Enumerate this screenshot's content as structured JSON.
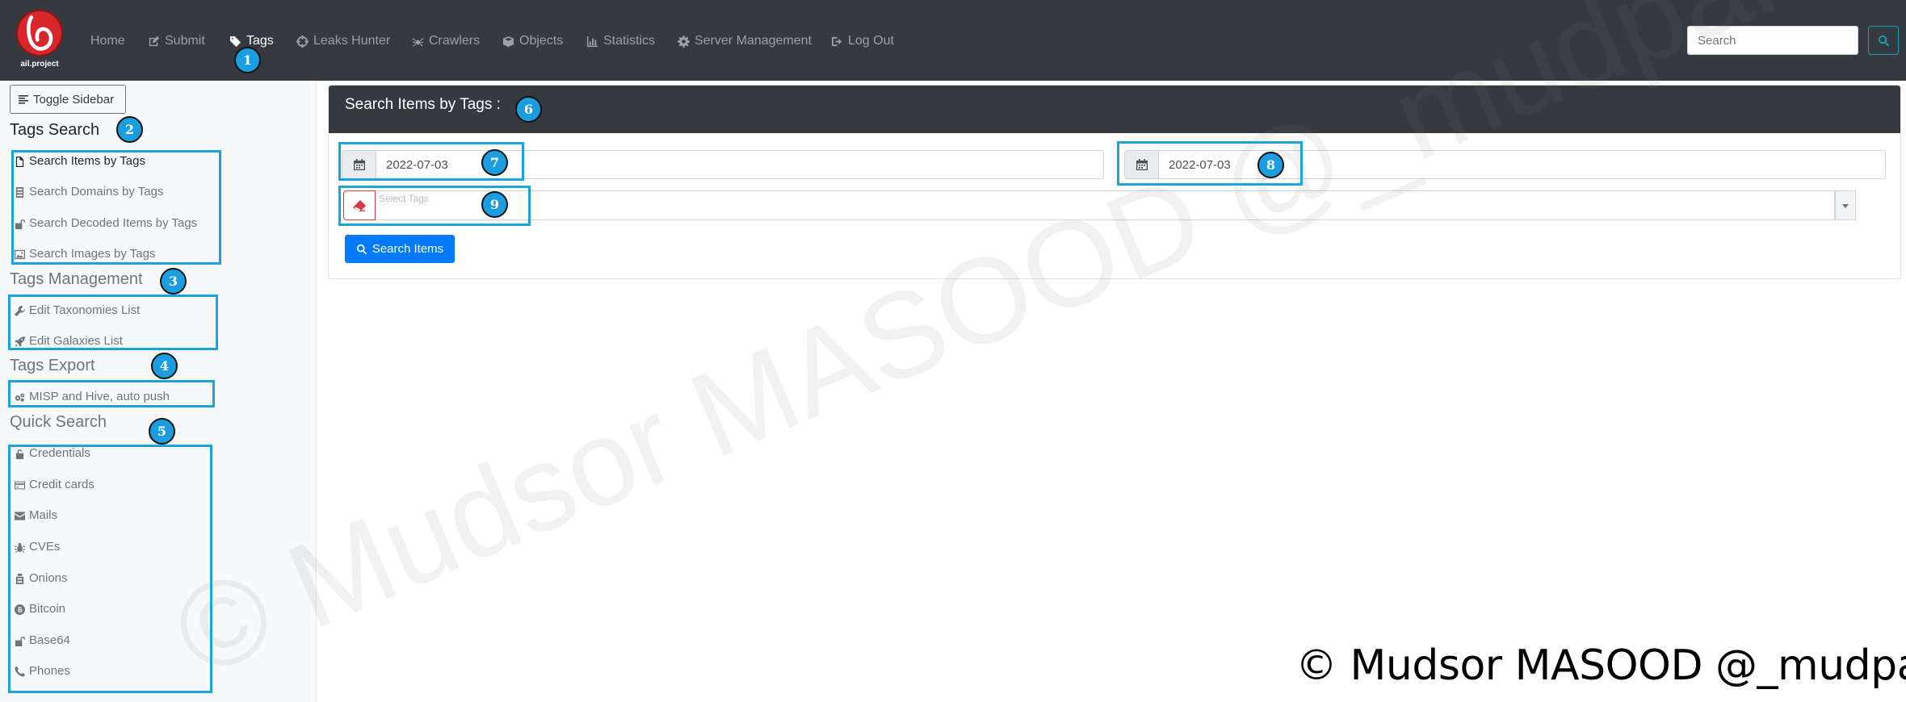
{
  "app": {
    "logo_text": "ail.project"
  },
  "nav": {
    "items": [
      {
        "label": "Home",
        "icon": "home-icon"
      },
      {
        "label": "Submit",
        "icon": "edit-icon"
      },
      {
        "label": "Tags",
        "icon": "tag-icon",
        "active": true
      },
      {
        "label": "Leaks Hunter",
        "icon": "crosshairs-icon"
      },
      {
        "label": "Crawlers",
        "icon": "spider-icon"
      },
      {
        "label": "Objects",
        "icon": "cube-icon"
      },
      {
        "label": "Statistics",
        "icon": "chart-icon"
      },
      {
        "label": "Server Management",
        "icon": "cog-icon"
      },
      {
        "label": "Log Out",
        "icon": "logout-icon"
      }
    ],
    "search_placeholder": "Search"
  },
  "sidebar": {
    "toggle_label": "Toggle Sidebar",
    "sections": [
      {
        "title": "Tags Search",
        "items": [
          {
            "label": "Search Items by Tags",
            "icon": "file-icon",
            "active": true
          },
          {
            "label": "Search Domains by Tags",
            "icon": "server-icon"
          },
          {
            "label": "Search Decoded Items by Tags",
            "icon": "unlock-icon"
          },
          {
            "label": "Search Images by Tags",
            "icon": "image-icon"
          }
        ]
      },
      {
        "title": "Tags Management",
        "items": [
          {
            "label": "Edit Taxonomies List",
            "icon": "wrench-icon"
          },
          {
            "label": "Edit Galaxies List",
            "icon": "rocket-icon"
          }
        ]
      },
      {
        "title": "Tags Export",
        "items": [
          {
            "label": "MISP and Hive, auto push",
            "icon": "cogs-icon"
          }
        ]
      },
      {
        "title": "Quick Search",
        "items": [
          {
            "label": "Credentials",
            "icon": "unlock-alt-icon"
          },
          {
            "label": "Credit cards",
            "icon": "credit-card-icon"
          },
          {
            "label": "Mails",
            "icon": "envelope-icon"
          },
          {
            "label": "CVEs",
            "icon": "bug-icon"
          },
          {
            "label": "Onions",
            "icon": "onion-icon"
          },
          {
            "label": "Bitcoin",
            "icon": "bitcoin-icon"
          },
          {
            "label": "Base64",
            "icon": "unlock-icon"
          },
          {
            "label": "Phones",
            "icon": "phone-icon"
          }
        ]
      }
    ]
  },
  "main": {
    "card_title": "Search Items by Tags :",
    "date_from": "2022-07-03",
    "date_to": "2022-07-03",
    "tags_placeholder": "Select Tags",
    "search_button": "Search Items"
  },
  "annotations": {
    "badges": [
      "1",
      "2",
      "3",
      "4",
      "5",
      "6",
      "7",
      "8",
      "9"
    ],
    "color": "#1ba3dd"
  },
  "watermark": {
    "text": "© Mudsor MASOOD @_mudpak"
  },
  "copyright": {
    "text": "© Mudsor MASOOD @_mudpak"
  }
}
